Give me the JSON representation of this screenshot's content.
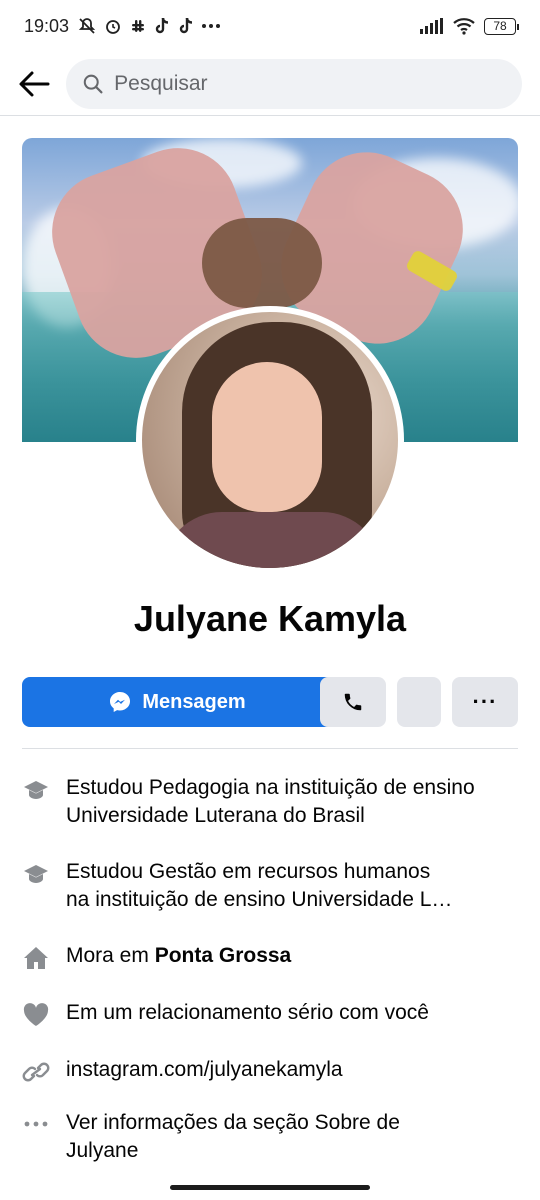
{
  "status_bar": {
    "time": "19:03",
    "notification_icons": [
      "mute-icon",
      "alarm-icon",
      "slack-icon",
      "tiktok-icon",
      "tiktok-icon",
      "more-dots-icon"
    ],
    "battery": "78"
  },
  "header": {
    "search_placeholder": "Pesquisar"
  },
  "profile": {
    "name": "Julyane Kamyla"
  },
  "actions": {
    "message_label": "Mensagem",
    "more_label": "···"
  },
  "details": {
    "education_1": "Estudou Pedagogia na instituição de ensino Universidade Luterana do Brasil",
    "education_2_line1": "Estudou Gestão em recursos humanos",
    "education_2_line2": "na instituição de ensino Universidade L…",
    "lives_prefix": "Mora em ",
    "lives_city": "Ponta Grossa",
    "relationship": "Em um relacionamento sério com você",
    "website": "instagram.com/julyanekamyla",
    "about_line1": "Ver informações da seção Sobre de",
    "about_line2": "Julyane"
  },
  "colors": {
    "accent": "#1b74e4",
    "button_gray": "#e4e6eb",
    "search_bg": "#f0f2f5",
    "icon_gray": "#65676b"
  }
}
